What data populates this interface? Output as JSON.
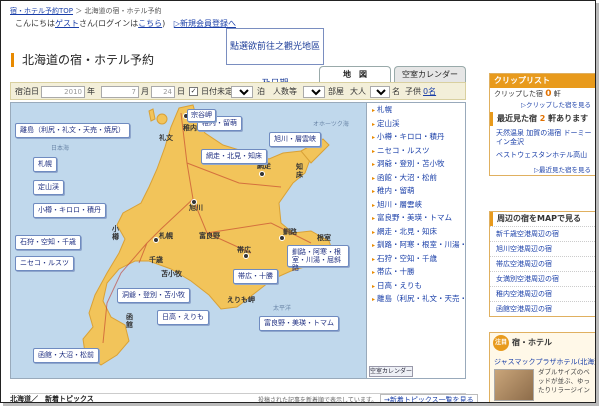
{
  "breadcrumb": {
    "home": "宿・ホテル予約TOP",
    "sep": "＞",
    "current": "北海道の宿・ホテル予約"
  },
  "greeting": {
    "text": "こんにちは",
    "guest": "ゲスト",
    "suffix": "さん(ログインは",
    "login": "こちら",
    "close": ")",
    "register": "▷新規会員登録へ"
  },
  "page_title": "北海道の宿・ホテル予約",
  "annotation": "點選欲前往之觀光地區及日期",
  "tabs": {
    "map": "地　図",
    "calendar": "空室カレンダー"
  },
  "search": {
    "checkin_label": "宿泊日",
    "year": "2010",
    "year_unit": "年",
    "month": "7",
    "month_unit": "月",
    "day": "24",
    "day_unit": "日",
    "undecided": "日付未定",
    "nights": "1",
    "nights_unit": "泊",
    "people_label": "人数等",
    "rooms": "1",
    "rooms_unit": "部屋",
    "adults_label": "大人",
    "adults": "2",
    "adults_unit": "名",
    "children_label": "子供",
    "children": "0名"
  },
  "map_areas": [
    "稚内・留萌",
    "宗谷岬",
    "旭川・層雲峡",
    "網走・北見・知床",
    "札幌",
    "定山渓",
    "小樽・キロロ・積丹",
    "石狩・空知・千歳",
    "ニセコ・ルスツ",
    "釧路・阿寒・根室・川湯・屈斜路",
    "帯広・十勝",
    "洞爺・登別・苫小牧",
    "日高・えりも",
    "富良野・美瑛・トマム",
    "函館・大沼・松前",
    "離島（利尻・礼文・天売・焼尻）"
  ],
  "map_cities": {
    "wakkanai": "稚内",
    "rishiri": "礼文",
    "abashiri": "網走",
    "asahikawa": "旭川",
    "furano": "富良野",
    "sapporo": "札幌",
    "otaru": "小樽",
    "obihiro": "帯広",
    "kushiro": "釧路",
    "hakodate": "函館",
    "chitose": "千歳",
    "tomakomai": "苫小牧",
    "shiretoko": "知床",
    "nemuro": "根室",
    "erimo": "えりも岬",
    "okhotsk": "オホーツク海",
    "sea_japan": "日本海",
    "pacific": "太平洋"
  },
  "area_list": [
    "札幌",
    "定山渓",
    "小樽・キロロ・積丹",
    "ニセコ・ルスツ",
    "洞爺・登別・苫小牧",
    "函館・大沼・松前",
    "稚内・留萌",
    "旭川・層雲峡",
    "富良野・美瑛・トマム",
    "網走・北見・知床",
    "釧路・阿寒・根室・川湯・屈斜路",
    "石狩・空知・千歳",
    "帯広・十勝",
    "日高・えりも",
    "離島（利尻・礼文・天売・焼尻）"
  ],
  "calendar_button": "空室カレンダー",
  "bottom": {
    "title": "北海道／　新着トピックス",
    "note": "投稿された記事を新着順で表示しています。",
    "more": "→新着トピックス一覧を見る"
  },
  "sidebar": {
    "clip_header": "クリップリスト",
    "clip_text_pre": "クリップした宿",
    "clip_count": "0",
    "clip_unit": "軒",
    "clip_link": "▷クリップした宿を見る",
    "recent_pre": "最近見た宿",
    "recent_count": "2",
    "recent_unit": "軒あります",
    "recent_items": [
      "天然温泉 加賀の湯宿 ドーミーイン金沢",
      "ベストウェスタンホテル高山"
    ],
    "recent_link": "▷最近見た宿を見る",
    "nearby_header": "周辺の宿をMAPで見る",
    "nearby_items": [
      "新千歳空港周辺の宿",
      "旭川空港周辺の宿",
      "帯広空港周辺の宿",
      "女満別空港周辺の宿",
      "稚内空港周辺の宿",
      "函館空港周辺の宿"
    ]
  },
  "hot": {
    "badge": "注目",
    "title": "宿・ホテル",
    "hotel": "ジャスマックプラザホテル(北海道)",
    "desc": "ダブルサイズのベッドが並ぶ、ゆったりリラージイン"
  }
}
